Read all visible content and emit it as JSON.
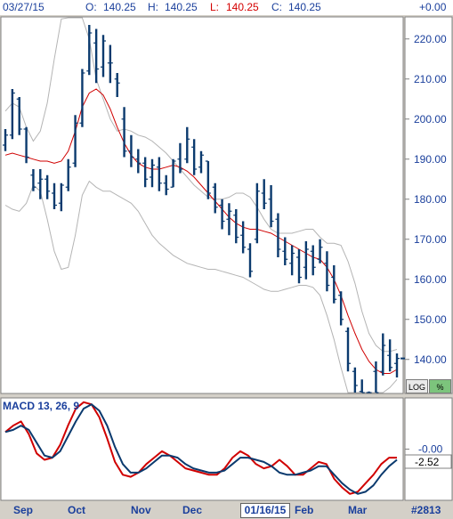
{
  "header": {
    "date": "03/27/15",
    "open_label": "O:",
    "open": "140.25",
    "high_label": "H:",
    "high": "140.25",
    "low_label": "L:",
    "low": "140.25",
    "close_label": "C:",
    "close": "140.25",
    "change": "+0.00"
  },
  "buttons": {
    "log": "LOG",
    "pct": "%"
  },
  "macd_value": "-2.52",
  "cursor_date": "01/16/15",
  "symbol_id": "#2813",
  "colors": {
    "bars": "#0b3a6e",
    "ma": "#d00000",
    "bands": "#b4b4b4",
    "macd": "#0b3a6e",
    "signal": "#d00000",
    "axis": "#1a3f9c"
  },
  "chart_data": [
    {
      "type": "ohlc",
      "title": "",
      "x_tick_labels": [
        "Sep",
        "Oct",
        "Nov",
        "Dec",
        "Feb",
        "Mar"
      ],
      "y_ticks": [
        140,
        150,
        160,
        170,
        180,
        190,
        200,
        210,
        220
      ],
      "y_tick_labels": [
        "140.00",
        "150.00",
        "160.00",
        "170.00",
        "180.00",
        "190.00",
        "200.00",
        "210.00",
        "220.00"
      ],
      "ylim": [
        131.5,
        225.5
      ],
      "moving_average": [
        191.0,
        191.5,
        191.0,
        190.5,
        190.0,
        189.5,
        189.5,
        189.0,
        189.5,
        192.0,
        197.0,
        203.0,
        206.5,
        207.5,
        206.0,
        202.5,
        198.0,
        194.0,
        191.0,
        189.0,
        188.0,
        187.5,
        187.5,
        188.0,
        188.5,
        188.0,
        187.0,
        185.5,
        183.5,
        181.5,
        179.5,
        177.5,
        175.5,
        174.0,
        173.0,
        172.5,
        172.5,
        172.0,
        171.5,
        170.5,
        169.5,
        168.5,
        167.5,
        166.5,
        165.5,
        165.0,
        163.0,
        160.0,
        156.0,
        151.0,
        146.5,
        142.5,
        139.5,
        137.5,
        136.5,
        136.5,
        137.5
      ],
      "upper_band": [
        202.0,
        204.0,
        203.0,
        198.0,
        194.5,
        197.0,
        204.0,
        215.0,
        225.0,
        229.0,
        231.0,
        228.0,
        220.0,
        210.0,
        205.0,
        200.0,
        197.0,
        197.5,
        197.0,
        196.0,
        195.5,
        194.5,
        193.0,
        191.5,
        189.5,
        187.5,
        185.5,
        183.5,
        182.0,
        180.5,
        180.0,
        180.0,
        180.5,
        181.5,
        181.5,
        180.5,
        178.0,
        175.0,
        172.5,
        171.5,
        171.5,
        171.5,
        172.0,
        172.5,
        172.5,
        170.5,
        169.0,
        169.0,
        168.5,
        164.5,
        159.0,
        152.0,
        146.5,
        143.5,
        142.0,
        142.0,
        142.5
      ],
      "lower_band": [
        178.5,
        177.5,
        177.0,
        179.0,
        183.5,
        182.0,
        175.0,
        167.0,
        162.5,
        163.0,
        171.0,
        181.0,
        184.5,
        183.0,
        182.0,
        182.0,
        181.0,
        180.0,
        179.0,
        177.0,
        174.0,
        171.0,
        169.0,
        167.5,
        166.0,
        165.0,
        164.0,
        163.5,
        163.0,
        162.5,
        162.5,
        162.0,
        161.5,
        161.0,
        160.5,
        159.5,
        158.5,
        157.5,
        157.0,
        157.0,
        157.5,
        158.0,
        158.5,
        158.5,
        158.0,
        156.0,
        151.0,
        145.0,
        138.0,
        131.0,
        127.0,
        126.0,
        127.0,
        129.0,
        131.0,
        133.0,
        135.0
      ],
      "ohlc": [
        [
          193.5,
          197.5,
          192.0,
          196.0
        ],
        [
          196.0,
          207.5,
          195.0,
          206.5
        ],
        [
          205.0,
          205.5,
          196.0,
          197.5
        ],
        [
          197.5,
          198.0,
          189.0,
          190.5
        ],
        [
          186.0,
          187.5,
          182.0,
          183.0
        ],
        [
          184.0,
          187.5,
          180.0,
          185.0
        ],
        [
          185.0,
          186.0,
          180.0,
          182.0
        ],
        [
          181.5,
          184.0,
          177.5,
          178.5
        ],
        [
          179.0,
          184.0,
          177.0,
          183.5
        ],
        [
          183.0,
          190.0,
          182.0,
          188.0
        ],
        [
          189.0,
          201.0,
          188.0,
          199.0
        ],
        [
          199.0,
          212.5,
          198.0,
          211.5
        ],
        [
          212.0,
          223.5,
          211.0,
          221.5
        ],
        [
          219.0,
          222.5,
          209.0,
          212.5
        ],
        [
          213.0,
          221.0,
          210.5,
          219.5
        ],
        [
          214.0,
          218.5,
          209.0,
          214.0
        ],
        [
          210.0,
          211.5,
          205.5,
          209.0
        ],
        [
          200.0,
          203.0,
          190.5,
          192.0
        ],
        [
          192.0,
          196.0,
          188.0,
          190.5
        ],
        [
          190.0,
          192.5,
          186.5,
          189.0
        ],
        [
          189.0,
          190.5,
          183.0,
          185.0
        ],
        [
          185.5,
          190.0,
          183.0,
          188.5
        ],
        [
          188.0,
          190.5,
          182.0,
          184.0
        ],
        [
          184.0,
          186.0,
          181.0,
          182.5
        ],
        [
          183.0,
          190.0,
          183.0,
          189.5
        ],
        [
          190.0,
          194.0,
          186.5,
          187.5
        ],
        [
          190.0,
          198.0,
          189.0,
          195.0
        ],
        [
          193.0,
          195.0,
          186.0,
          187.5
        ],
        [
          188.0,
          192.0,
          186.5,
          191.0
        ],
        [
          189.5,
          189.5,
          180.0,
          181.5
        ],
        [
          183.0,
          184.0,
          176.5,
          178.0
        ],
        [
          178.5,
          180.0,
          172.5,
          174.5
        ],
        [
          175.0,
          179.0,
          171.0,
          177.0
        ],
        [
          176.0,
          177.5,
          169.0,
          170.5
        ],
        [
          171.0,
          174.5,
          166.5,
          168.0
        ],
        [
          167.5,
          169.0,
          160.5,
          162.0
        ],
        [
          170.0,
          184.0,
          169.0,
          182.0
        ],
        [
          181.5,
          185.0,
          177.5,
          179.0
        ],
        [
          180.0,
          183.5,
          173.0,
          174.5
        ],
        [
          175.0,
          176.5,
          165.5,
          167.5
        ],
        [
          167.0,
          170.5,
          163.5,
          165.0
        ],
        [
          164.0,
          168.5,
          161.0,
          166.5
        ],
        [
          165.5,
          167.5,
          159.0,
          160.5
        ],
        [
          163.0,
          169.5,
          160.0,
          167.5
        ],
        [
          167.0,
          168.5,
          161.0,
          163.0
        ],
        [
          165.0,
          170.0,
          164.0,
          168.0
        ],
        [
          164.0,
          167.0,
          157.0,
          158.5
        ],
        [
          160.5,
          163.5,
          154.0,
          155.0
        ],
        [
          156.0,
          157.0,
          148.5,
          150.0
        ],
        [
          147.0,
          148.0,
          137.0,
          139.0
        ],
        [
          137.0,
          138.0,
          131.0,
          133.5
        ],
        [
          132.0,
          135.0,
          125.5,
          127.5
        ],
        [
          131.0,
          132.0,
          127.5,
          129.0
        ],
        [
          137.0,
          139.5,
          129.0,
          130.5
        ],
        [
          137.0,
          146.5,
          136.0,
          143.5
        ],
        [
          141.0,
          145.0,
          137.0,
          138.0
        ],
        [
          139.0,
          141.5,
          135.5,
          140.25
        ]
      ]
    },
    {
      "type": "line",
      "title": "MACD 13, 26, 9",
      "y_ticks": [
        0
      ],
      "y_tick_labels": [
        "-0.00"
      ],
      "ylim": [
        -12,
        12
      ],
      "series": [
        {
          "name": "MACD",
          "values": [
            4.0,
            4.5,
            5.5,
            4.5,
            1.5,
            -1.5,
            -2.0,
            -0.5,
            3.0,
            6.5,
            9.5,
            10.5,
            9.0,
            5.5,
            0.5,
            -3.5,
            -5.5,
            -5.5,
            -4.5,
            -3.0,
            -1.5,
            -1.5,
            -2.0,
            -3.5,
            -4.5,
            -5.0,
            -5.5,
            -5.5,
            -5.0,
            -3.5,
            -2.0,
            -2.0,
            -2.5,
            -3.0,
            -4.0,
            -5.5,
            -6.0,
            -6.0,
            -5.5,
            -5.0,
            -4.0,
            -4.0,
            -6.0,
            -8.0,
            -9.5,
            -10.5,
            -10.0,
            -8.5,
            -6.0,
            -4.0,
            -2.5
          ]
        },
        {
          "name": "Signal",
          "values": [
            4.0,
            5.5,
            6.5,
            3.5,
            -1.0,
            -2.5,
            -2.0,
            1.0,
            5.5,
            9.5,
            11.0,
            10.5,
            7.5,
            2.5,
            -3.0,
            -6.0,
            -6.5,
            -5.5,
            -3.5,
            -2.0,
            -0.5,
            -1.5,
            -3.0,
            -4.5,
            -5.0,
            -5.5,
            -6.0,
            -6.0,
            -4.5,
            -2.0,
            -0.5,
            -1.5,
            -3.5,
            -4.5,
            -4.0,
            -2.5,
            -4.0,
            -6.0,
            -6.0,
            -4.5,
            -3.0,
            -3.5,
            -7.0,
            -9.0,
            -10.5,
            -10.0,
            -8.0,
            -6.0,
            -3.5,
            -2.0,
            -2.0
          ]
        }
      ]
    }
  ]
}
